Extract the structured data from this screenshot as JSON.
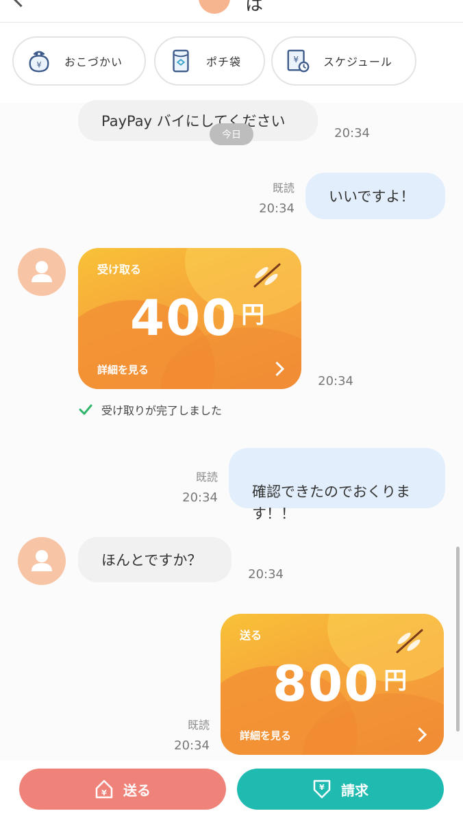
{
  "header": {
    "title": "は"
  },
  "chips": [
    {
      "label": "おこづかい",
      "icon": "coin-purse-icon"
    },
    {
      "label": "ポチ袋",
      "icon": "envelope-icon"
    },
    {
      "label": "スケジュール",
      "icon": "calendar-clock-icon"
    }
  ],
  "chat": {
    "day_label": "今日",
    "messages": [
      {
        "side": "in",
        "text": "PayPay バイにしてください",
        "time": "20:34"
      },
      {
        "side": "out",
        "text": "いいですよ！",
        "read": "既読",
        "time": "20:34"
      },
      {
        "side": "in",
        "card": {
          "kind": "受け取る",
          "amount": "400",
          "currency": "円",
          "details": "詳細を見る"
        },
        "time": "20:34"
      },
      {
        "status": "受け取りが完了しました"
      },
      {
        "side": "out",
        "text": "確認できたのでおくりま\nす！！",
        "read": "既読",
        "time": "20:34"
      },
      {
        "side": "in",
        "text": "ほんとですか？",
        "time": "20:34"
      },
      {
        "side": "out",
        "card": {
          "kind": "送る",
          "amount": "800",
          "currency": "円",
          "details": "詳細を見る"
        },
        "read": "既読",
        "time": "20:34"
      }
    ]
  },
  "actions": {
    "send_label": "送る",
    "request_label": "請求"
  },
  "colors": {
    "send_button": "#f08379",
    "request_button": "#1fbbb0",
    "outgoing_bubble": "#e2eefb",
    "incoming_bubble": "#f1f1f1",
    "card_orange": "#f6a53a"
  }
}
